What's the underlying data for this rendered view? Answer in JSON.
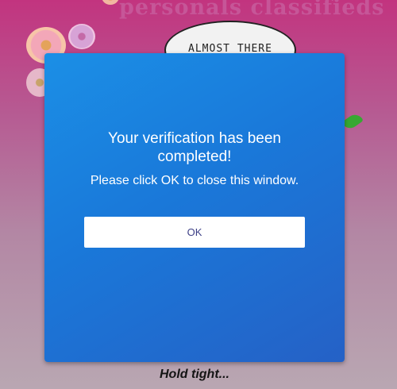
{
  "background": {
    "site_title": "personals classifieds",
    "speech_bubble_text": "ALMOST THERE"
  },
  "modal": {
    "heading": "Your verification has been completed!",
    "message": "Please click OK to close this window.",
    "ok_label": "OK"
  },
  "footer": {
    "text": "Hold tight..."
  },
  "colors": {
    "modal_blue": "#1a78d9",
    "background_pink": "#c2347f"
  }
}
